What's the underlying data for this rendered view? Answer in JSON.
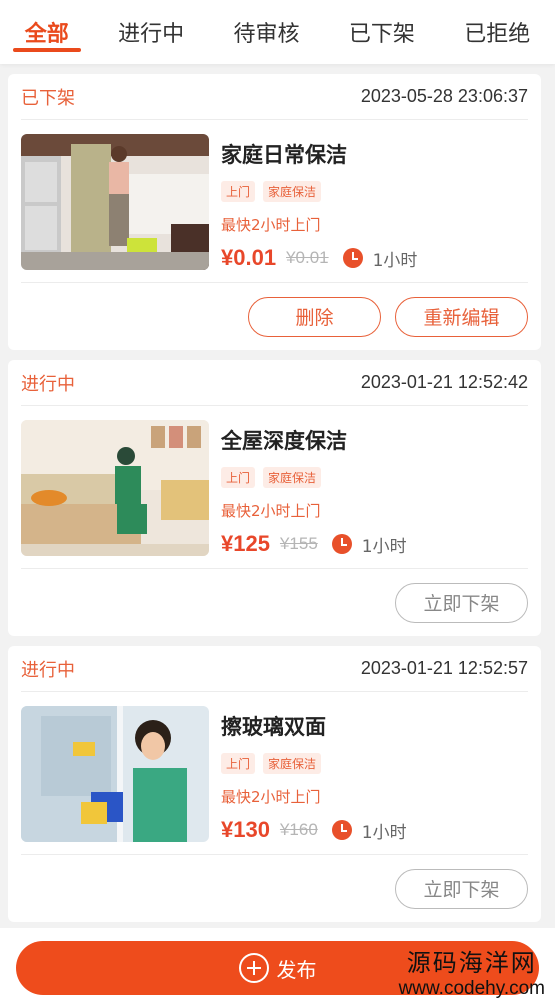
{
  "tabs": [
    "全部",
    "进行中",
    "待审核",
    "已下架",
    "已拒绝"
  ],
  "active_tab": 0,
  "orders": [
    {
      "status": "已下架",
      "time": "2023-05-28 23:06:37",
      "title": "家庭日常保洁",
      "tags": [
        "上门",
        "家庭保洁"
      ],
      "eta": "最快2小时上门",
      "price": "¥0.01",
      "original_price": "¥0.01",
      "duration": "1小时",
      "buttons": [
        "删除",
        "重新编辑"
      ]
    },
    {
      "status": "进行中",
      "time": "2023-01-21 12:52:42",
      "title": "全屋深度保洁",
      "tags": [
        "上门",
        "家庭保洁"
      ],
      "eta": "最快2小时上门",
      "price": "¥125",
      "original_price": "¥155",
      "duration": "1小时",
      "buttons": [
        "立即下架"
      ]
    },
    {
      "status": "进行中",
      "time": "2023-01-21 12:52:57",
      "title": "擦玻璃双面",
      "tags": [
        "上门",
        "家庭保洁"
      ],
      "eta": "最快2小时上门",
      "price": "¥130",
      "original_price": "¥160",
      "duration": "1小时",
      "buttons": [
        "立即下架"
      ]
    }
  ],
  "publish_label": "发布",
  "watermark": {
    "line1": "源码海洋网",
    "line2": "www.codehy.com"
  },
  "colors": {
    "accent": "#ea4a1c",
    "tag_bg": "#fdece6"
  }
}
